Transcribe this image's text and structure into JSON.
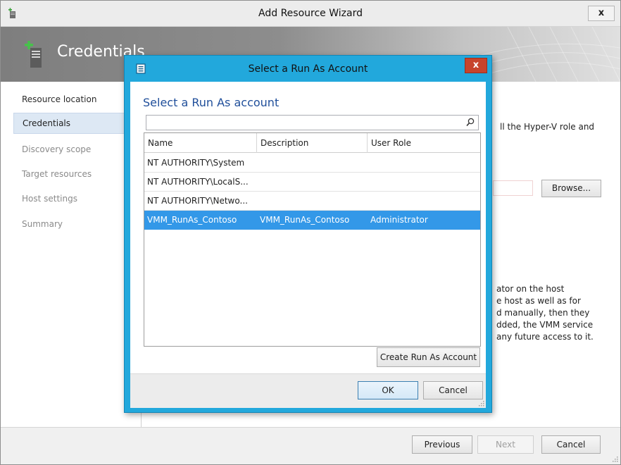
{
  "wizard": {
    "title": "Add Resource Wizard",
    "close_glyph": "x",
    "header_title": "Credentials",
    "header_icon": "server-add-icon",
    "nav": [
      {
        "label": "Resource location",
        "state": "done"
      },
      {
        "label": "Credentials",
        "state": "active"
      },
      {
        "label": "Discovery scope",
        "state": "pending"
      },
      {
        "label": "Target resources",
        "state": "pending"
      },
      {
        "label": "Host settings",
        "state": "done"
      },
      {
        "label": "Summary",
        "state": "done"
      }
    ],
    "content": {
      "text_line": "ll the Hyper-V role and",
      "browse_label": "Browse...",
      "paragraph": [
        "ator on the host",
        "e host as well as for",
        "d manually, then they",
        "dded, the VMM service",
        "any future access to it."
      ]
    },
    "footer": {
      "previous_label": "Previous",
      "next_label": "Next",
      "cancel_label": "Cancel"
    }
  },
  "dialog": {
    "title": "Select a Run As Account",
    "close_glyph": "x",
    "heading": "Select a Run As account",
    "search": {
      "value": "",
      "placeholder": ""
    },
    "columns": [
      "Name",
      "Description",
      "User Role"
    ],
    "rows": [
      {
        "name": "NT AUTHORITY\\System",
        "description": "",
        "role": "",
        "selected": false
      },
      {
        "name": "NT AUTHORITY\\LocalS...",
        "description": "",
        "role": "",
        "selected": false
      },
      {
        "name": "NT AUTHORITY\\Netwo...",
        "description": "",
        "role": "",
        "selected": false
      },
      {
        "name": "VMM_RunAs_Contoso",
        "description": "VMM_RunAs_Contoso",
        "role": "Administrator",
        "selected": true
      }
    ],
    "create_label": "Create Run As Account",
    "ok_label": "OK",
    "cancel_label": "Cancel"
  },
  "colors": {
    "dialog_frame": "#22a8dc",
    "selection": "#3398e8",
    "heading_blue": "#1f4e9a",
    "close_red": "#c7442c"
  }
}
